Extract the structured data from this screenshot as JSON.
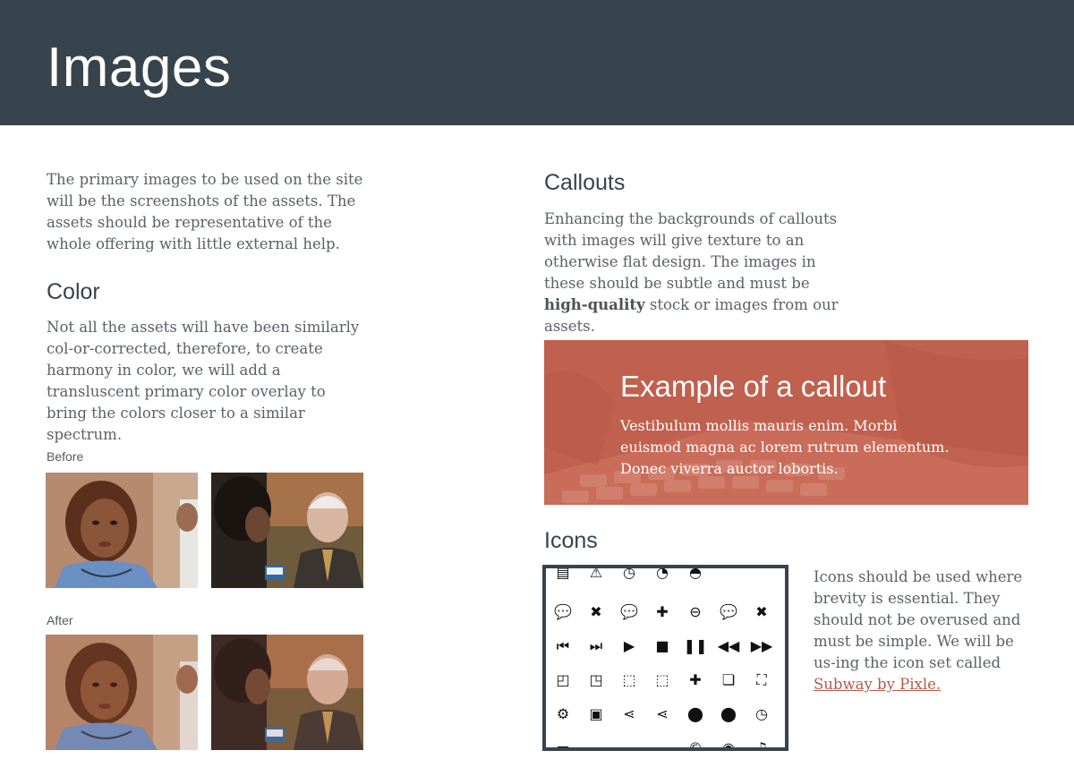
{
  "header": {
    "title": "Images"
  },
  "intro": "The primary images to be used on the site will be the screenshots of the assets. The assets should be representative of the whole offering with little external help.",
  "color_section": {
    "heading": "Color",
    "body": "Not all the assets will have been similarly col-or-corrected, therefore, to create harmony in color, we will add a transluscent primary color overlay to bring the colors closer to a similar spectrum.",
    "before_label": "Before",
    "after_label": "After"
  },
  "callouts_section": {
    "heading": "Callouts",
    "body_pre": "Enhancing the backgrounds of callouts with images will give texture to an otherwise flat design. The images in these should be subtle and must be ",
    "body_bold": "high-quality",
    "body_post": " stock or images from our assets.",
    "example_title": "Example of a callout",
    "example_body": "Vestibulum mollis mauris enim. Morbi euismod magna ac lorem rutrum elementum. Donec viverra auctor lobortis."
  },
  "icons_section": {
    "heading": "Icons",
    "body_pre": "Icons should be used where brevity is essential. They should not be overused and must be simple. We will be us-ing the icon set called ",
    "link_text": "Subway by Pixle.",
    "icons": [
      "▤",
      "⚠",
      "◷",
      "◔",
      "◓",
      "💬",
      "✖",
      "💬",
      "✚",
      "⊖",
      "💬",
      "✖",
      "⏮",
      "⏭",
      "▶",
      "■",
      "❚❚",
      "◀◀",
      "▶▶",
      "◰",
      "◳",
      "⬚",
      "⬚",
      "✚",
      "❏",
      "⛶",
      "⚙",
      "▣",
      "⋖",
      "⋖",
      "⬤",
      "⬤",
      "◷",
      "▬",
      "☁",
      "☁",
      "☁",
      "©",
      "◉",
      "♫"
    ]
  },
  "colors": {
    "header_bg": "#37434d",
    "callout_bg": "#c0604e",
    "link": "#b45a48"
  }
}
